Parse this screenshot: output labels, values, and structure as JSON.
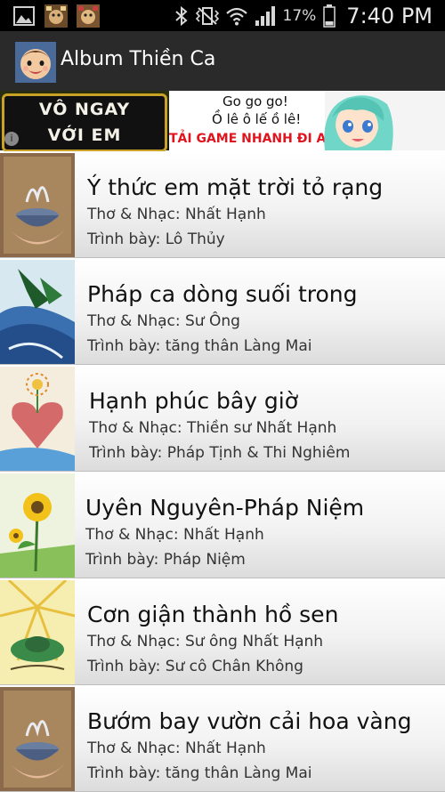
{
  "status_bar": {
    "battery_percent": "17%",
    "time": "7:40 PM",
    "icons": [
      "gallery-notification-icon",
      "game-notification-icon",
      "game-notification-icon",
      "bluetooth-icon",
      "vibrate-icon",
      "wifi-icon",
      "signal-icon",
      "battery-icon"
    ]
  },
  "action_bar": {
    "title": "Album Thiền Ca",
    "icon": "baby-app-icon"
  },
  "ad": {
    "plaque_line1": "VÔ NGAY",
    "plaque_line2": "VỚI EM",
    "line1": "Go go go!",
    "line2": "Ồ lê ô lế ồ lê!",
    "cta": "TẢI GAME NHANH ĐI ANH",
    "info_icon": "info-icon"
  },
  "songs": [
    {
      "title": "Ý thức em mặt trời tỏ rạng",
      "author": "Thơ & Nhạc: Nhất Hạnh",
      "performer": "Trình bày: Lô Thủy",
      "thumb": "bowl-painting-icon"
    },
    {
      "title": "Pháp ca dòng suối trong",
      "author": "Thơ & Nhạc: Sư Ông",
      "performer": "Trình bày: tăng thân Làng Mai",
      "thumb": "leaf-water-painting-icon"
    },
    {
      "title": "Hạnh phúc bây giờ",
      "author": "Thơ & Nhạc: Thiền sư Nhất Hạnh",
      "performer": "Trình bày: Pháp Tịnh & Thi Nghiêm",
      "thumb": "heart-flower-painting-icon"
    },
    {
      "title": "Uyên Nguyên-Pháp Niệm",
      "author": "Thơ & Nhạc: Nhất Hạnh",
      "performer": "Trình bày: Pháp Niệm",
      "thumb": "sunflower-painting-icon"
    },
    {
      "title": "Cơn giận thành hồ sen",
      "author": "Thơ & Nhạc: Sư ông Nhất Hạnh",
      "performer": "Trình bày: Sư cô Chân Không",
      "thumb": "lotus-painting-icon"
    },
    {
      "title": "Bướm bay vườn cải hoa vàng",
      "author": "Thơ & Nhạc: Nhất Hạnh",
      "performer": "Trình bày: tăng thân Làng Mai",
      "thumb": "bowl-painting-icon"
    }
  ]
}
